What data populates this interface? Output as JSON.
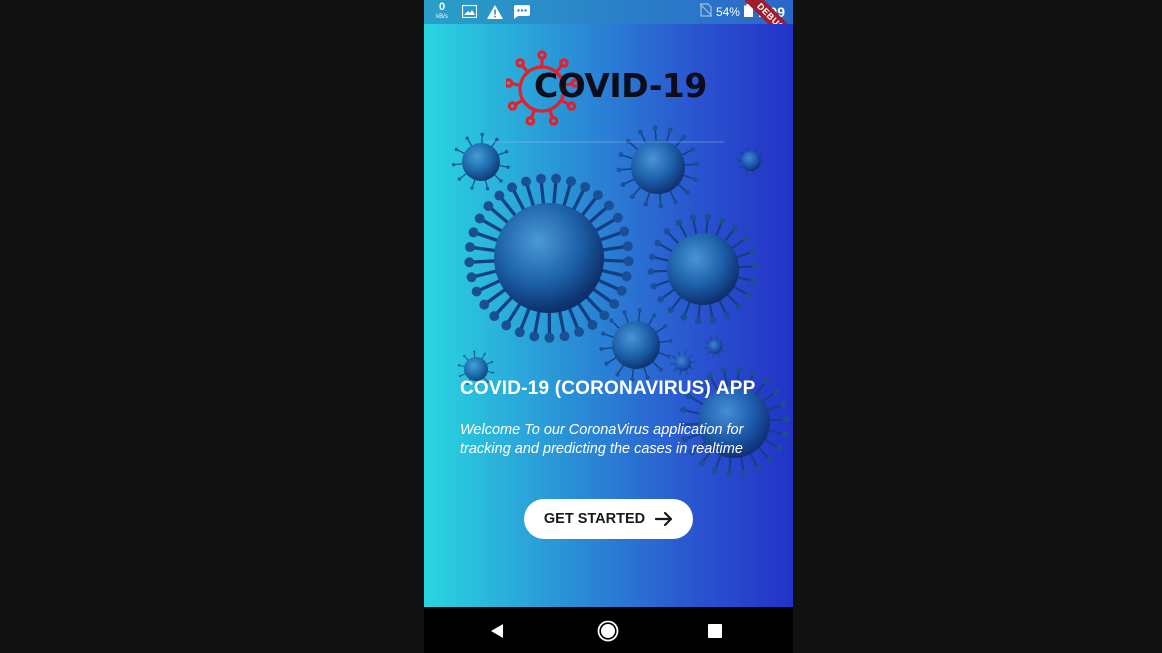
{
  "status_bar": {
    "net_speed_value": "0",
    "net_speed_unit": "kB/s",
    "battery": "54%",
    "time": "7:09",
    "debug_label": "DEBUG"
  },
  "logo": {
    "text": "COVID-19",
    "virus_color": "#e0222e"
  },
  "app": {
    "title": "COVID-19 (CORONAVIRUS) APP",
    "description": "Welcome To our CoronaVirus application for tracking and predicting the cases in realtime",
    "cta_label": "GET STARTED"
  },
  "colors": {
    "gradient_start": "#29d6e0",
    "gradient_end": "#2233c6",
    "button_bg": "#ffffff"
  },
  "icons": {
    "status_left": [
      "image-icon",
      "warning-icon",
      "message-icon"
    ],
    "status_right": [
      "no-sim-icon",
      "battery-icon"
    ],
    "nav": [
      "back-icon",
      "home-icon",
      "recents-icon"
    ]
  }
}
